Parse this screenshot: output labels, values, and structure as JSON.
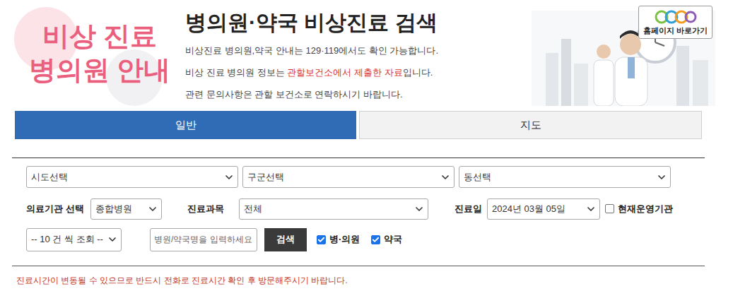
{
  "hero": {
    "lines": [
      "비상 진료",
      "병의원 안내"
    ]
  },
  "header": {
    "title": "병의원·약국 비상진료 검색",
    "notices": [
      {
        "segments": [
          {
            "text": "비상진료 병의원,약국 안내는 129·119에서도 확인 가능합니다.",
            "highlight": false
          }
        ]
      },
      {
        "segments": [
          {
            "text": "비상 진료 병의원 정보는 ",
            "highlight": false
          },
          {
            "text": "관할보건소에서 제출한 자료",
            "highlight": true
          },
          {
            "text": "입니다.",
            "highlight": false
          }
        ]
      },
      {
        "segments": [
          {
            "text": "관련 문의사항은 관할 보건소로 연락하시기 바랍니다.",
            "highlight": false
          }
        ]
      }
    ]
  },
  "homepage_link": {
    "label": "홈페이지 바로가기"
  },
  "tabs": [
    {
      "label": "일반",
      "selected": true
    },
    {
      "label": "지도",
      "selected": false
    }
  ],
  "region_selects": [
    {
      "value": "시도선택"
    },
    {
      "value": "구군선택"
    },
    {
      "value": "동선택"
    }
  ],
  "filters": {
    "institution": {
      "label": "의료기관 선택",
      "value": "종합병원"
    },
    "department": {
      "label": "진료과목",
      "value": "전체"
    },
    "date": {
      "label": "진료일",
      "value": "2024년 03월 05일"
    },
    "operating_now": {
      "label": "현재운영기관",
      "checked": false
    }
  },
  "search": {
    "page_size": "-- 10 건 씩 조회 --",
    "placeholder": "병원/약국명을 입력하세요",
    "button": "검색",
    "types": [
      {
        "label": "병·의원",
        "checked": true
      },
      {
        "label": "약국",
        "checked": true
      }
    ]
  },
  "footer_note": "진료시간이 변동될 수 있으므로 반드시 전화로 진료시간 확인 후 방문해주시기 바랍니다."
}
